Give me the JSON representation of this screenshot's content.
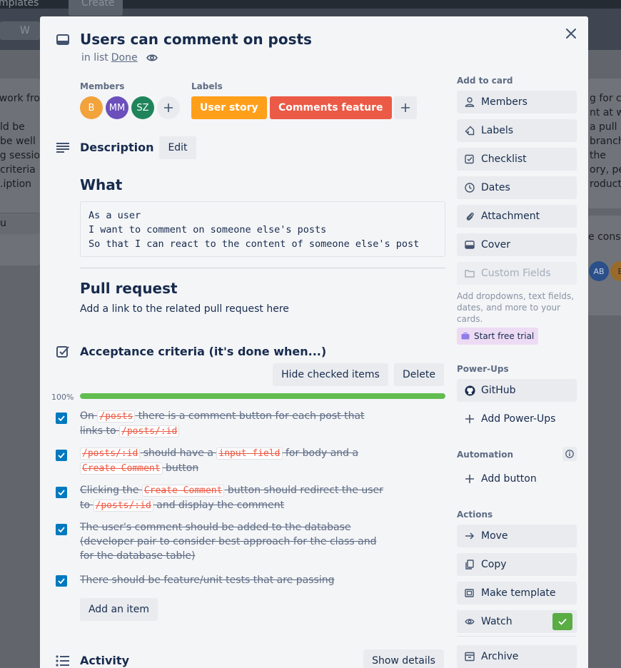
{
  "background": {
    "nav_tab": "mplates",
    "nav_create": "Create",
    "nav_filter": "W",
    "left_lines": [
      "work fro",
      "",
      "ld be",
      "be well",
      "g sessio",
      "criteria",
      "iption."
    ],
    "left_footer": "u",
    "right_lines": [
      "g for c",
      "nt at w",
      "a pull",
      "branch.",
      "the",
      "ory, per",
      "roduct"
    ],
    "right_card_text": "e consu",
    "right_avatar": "AB",
    "right_avatar2": "E"
  },
  "card": {
    "title": "Users can comment on posts",
    "in_list_prefix": "in list",
    "list_name": "Done",
    "members_heading": "Members",
    "members": [
      {
        "initials": "B",
        "color": "#f2a33c"
      },
      {
        "initials": "MM",
        "color": "#6b4fbb"
      },
      {
        "initials": "SZ",
        "color": "#1f845a"
      }
    ],
    "labels_heading": "Labels",
    "labels": [
      {
        "text": "User story",
        "color": "#ff9f1a"
      },
      {
        "text": "Comments feature",
        "color": "#eb5a46"
      }
    ],
    "description": {
      "heading": "Description",
      "edit_label": "Edit",
      "what_heading": "What",
      "what_code": "As a user\nI want to comment on someone else's posts\nSo that I can react to the content of someone else's post",
      "pr_heading": "Pull request",
      "pr_text": "Add a link to the related pull request here"
    },
    "checklist": {
      "title": "Acceptance criteria (it's done when...)",
      "hide_label": "Hide checked items",
      "delete_label": "Delete",
      "percent_label": "100%",
      "progress": 1.0,
      "items": [
        [
          {
            "t": "On "
          },
          {
            "c": "/posts"
          },
          {
            "t": " there is a comment button for each post that links to "
          },
          {
            "c": "/posts/:id"
          }
        ],
        [
          {
            "c": "/posts/:id"
          },
          {
            "t": " should have a "
          },
          {
            "c": "input field"
          },
          {
            "t": " for body and a "
          },
          {
            "c": "Create Comment"
          },
          {
            "t": " button"
          }
        ],
        [
          {
            "t": "Clicking the "
          },
          {
            "c": "Create Comment"
          },
          {
            "t": " button should redirect the user to "
          },
          {
            "c": "/posts/:id"
          },
          {
            "t": " and display the comment"
          }
        ],
        [
          {
            "t": "The user's comment should be added to the database (developer pair to consider best approach for the class and for the database table)"
          }
        ],
        [
          {
            "t": "There should be feature/unit tests that are passing"
          }
        ]
      ],
      "add_item_label": "Add an item"
    },
    "activity": {
      "heading": "Activity",
      "show_details_label": "Show details"
    }
  },
  "sidebar": {
    "add_to_card_heading": "Add to card",
    "add_to_card": [
      {
        "label": "Members",
        "icon": "person-icon"
      },
      {
        "label": "Labels",
        "icon": "tag-icon"
      },
      {
        "label": "Checklist",
        "icon": "checklist-icon"
      },
      {
        "label": "Dates",
        "icon": "clock-icon"
      },
      {
        "label": "Attachment",
        "icon": "paperclip-icon"
      },
      {
        "label": "Cover",
        "icon": "cover-icon"
      }
    ],
    "custom_fields_label": "Custom Fields",
    "custom_fields_note": "Add dropdowns, text fields, dates, and more to your cards.",
    "free_trial_label": "Start free trial",
    "powerups_heading": "Power-Ups",
    "github_label": "GitHub",
    "add_powerups_label": "Add Power-Ups",
    "automation_heading": "Automation",
    "add_button_label": "Add button",
    "actions_heading": "Actions",
    "actions": [
      {
        "label": "Move",
        "icon": "arrow-right-icon"
      },
      {
        "label": "Copy",
        "icon": "copy-icon"
      },
      {
        "label": "Make template",
        "icon": "template-icon"
      },
      {
        "label": "Watch",
        "icon": "eye-icon"
      }
    ],
    "archive_label": "Archive",
    "watch_checked": true
  }
}
